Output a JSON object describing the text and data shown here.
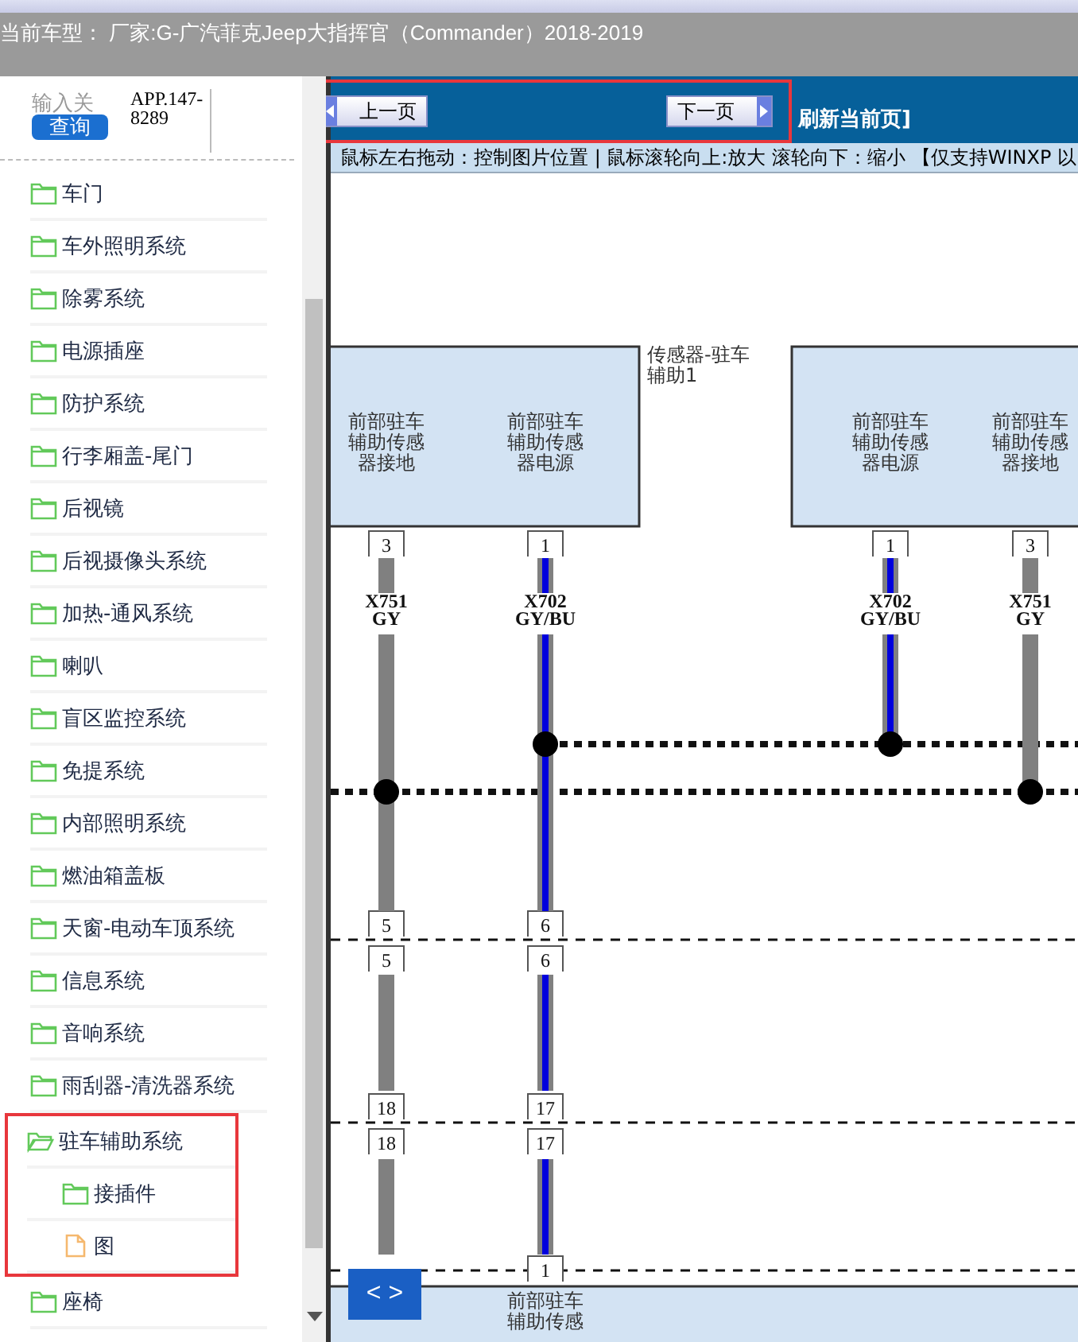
{
  "header": {
    "title": "当前车型：  厂家:G-广汽菲克Jeep大指挥官（Commander）2018-2019"
  },
  "sidebar": {
    "search": {
      "placeholder": "输入关",
      "button": "查询"
    },
    "phone": "APP.147-8289",
    "tree": [
      {
        "label": "车门",
        "kind": "folder",
        "expanded": false
      },
      {
        "label": "车外照明系统",
        "kind": "folder",
        "expanded": false
      },
      {
        "label": "除雾系统",
        "kind": "folder",
        "expanded": false
      },
      {
        "label": "电源插座",
        "kind": "folder",
        "expanded": false
      },
      {
        "label": "防护系统",
        "kind": "folder",
        "expanded": false
      },
      {
        "label": "行李厢盖-尾门",
        "kind": "folder",
        "expanded": false
      },
      {
        "label": "后视镜",
        "kind": "folder",
        "expanded": false
      },
      {
        "label": "后视摄像头系统",
        "kind": "folder",
        "expanded": false
      },
      {
        "label": "加热-通风系统",
        "kind": "folder",
        "expanded": false
      },
      {
        "label": "喇叭",
        "kind": "folder",
        "expanded": false
      },
      {
        "label": "盲区监控系统",
        "kind": "folder",
        "expanded": false
      },
      {
        "label": "免提系统",
        "kind": "folder",
        "expanded": false
      },
      {
        "label": "内部照明系统",
        "kind": "folder",
        "expanded": false
      },
      {
        "label": "燃油箱盖板",
        "kind": "folder",
        "expanded": false
      },
      {
        "label": "天窗-电动车顶系统",
        "kind": "folder",
        "expanded": false
      },
      {
        "label": "信息系统",
        "kind": "folder",
        "expanded": false
      },
      {
        "label": "音响系统",
        "kind": "folder",
        "expanded": false
      },
      {
        "label": "雨刮器-清洗器系统",
        "kind": "folder",
        "expanded": false
      },
      {
        "label": "驻车辅助系统",
        "kind": "folder",
        "expanded": true,
        "annotated": true,
        "children": [
          {
            "label": "接插件",
            "kind": "folder",
            "expanded": false
          },
          {
            "label": "图",
            "kind": "file"
          }
        ]
      },
      {
        "label": "座椅",
        "kind": "folder",
        "expanded": false
      }
    ]
  },
  "toolbar": {
    "prev": "上一页",
    "next": "下一页",
    "annotated": true,
    "refresh": "刷新当前页]",
    "hint": "鼠标左右拖动：控制图片位置 | 鼠标滚轮向上:放大  滚轮向下：缩小 【仅支持WINXP 以"
  },
  "diagram": {
    "caption": "传感器-驻车辅助1",
    "pan_button": "< >",
    "columns": [
      {
        "label": "前部驻车辅助传感器接地",
        "pin": "3",
        "wire": "X751",
        "code": "GY",
        "color": "#808080",
        "upper_splice": false,
        "breaks": [
          {
            "upper": "5",
            "lower": "5"
          },
          {
            "upper": "18",
            "lower": "18"
          }
        ]
      },
      {
        "label": "前部驻车辅助传感器电源",
        "pin": "1",
        "wire": "X702",
        "code": "GY/BU",
        "color": "#0000dd",
        "upper_splice": true,
        "breaks": [
          {
            "upper": "6",
            "lower": "6"
          },
          {
            "upper": "17",
            "lower": "17"
          }
        ],
        "end_pin": "1",
        "bottom_label": "前部驻车辅助传感"
      },
      {
        "label": "前部驻车辅助传感器电源",
        "pin": "1",
        "wire": "X702",
        "code": "GY/BU",
        "color": "#0000dd",
        "upper_splice": true
      },
      {
        "label": "前部驻车辅助传感器接地",
        "pin": "3",
        "wire": "X751",
        "code": "GY",
        "color": "#808080",
        "upper_splice": false
      }
    ]
  }
}
